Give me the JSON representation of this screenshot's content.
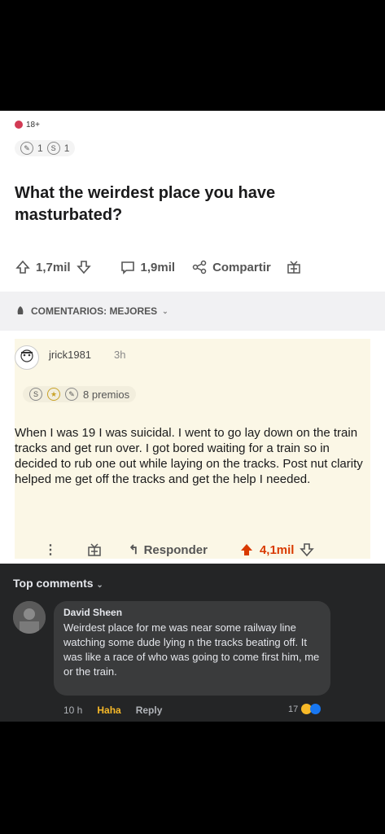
{
  "reddit": {
    "nsfw_label": "18+",
    "awards_top": [
      {
        "icon": "chat-award-icon",
        "count": "1"
      },
      {
        "icon": "silver-award-icon",
        "count": "1"
      }
    ],
    "post_title": "What the weirdest place you have masturbated?",
    "actions": {
      "upvotes": "1,7mil",
      "comments": "1,9mil",
      "share_label": "Compartir"
    },
    "sort_label": "COMENTARIOS: MEJORES",
    "comment": {
      "username": "jrick1981",
      "time": "3h",
      "awards_label": "8 premios",
      "body": "When I was 19 I was suicidal. I went to go lay down on the train tracks and get run over. I got bored waiting for a train so in decided to rub one out while laying on the tracks. Post nut clarity helped me get off the tracks and get the help I needed.",
      "reply_label": "Responder",
      "score": "4,1mil"
    },
    "colors": {
      "upvote": "#d93a00",
      "nsfw": "#d23a54"
    }
  },
  "facebook": {
    "top_comments_label": "Top comments",
    "comment": {
      "author": "David Sheen",
      "text": "Weirdest place for me was near some railway line watching some dude lying n the tracks beating off. It was like a race of who was going to come first him, me or the train.",
      "time": "10 h",
      "haha_label": "Haha",
      "reply_label": "Reply",
      "reaction_count": "17"
    },
    "colors": {
      "background": "#242526",
      "bubble": "#3a3b3c"
    }
  }
}
